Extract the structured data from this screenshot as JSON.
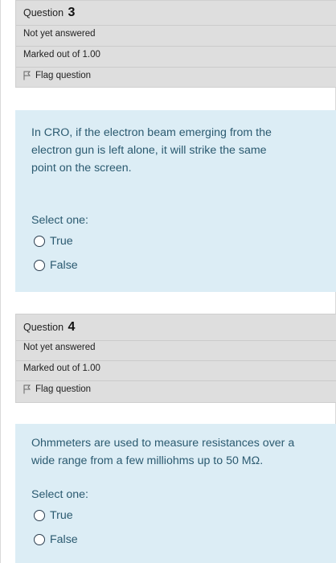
{
  "questions": [
    {
      "label": "Question",
      "number": "3",
      "state": "Not yet answered",
      "marks": "Marked out of 1.00",
      "flag_label": "Flag question",
      "text": "In CRO, if the electron beam emerging from the electron gun is left alone, it will strike the same point on the screen.",
      "prompt": "Select one:",
      "options": [
        "True",
        "False"
      ]
    },
    {
      "label": "Question",
      "number": "4",
      "state": "Not yet answered",
      "marks": "Marked out of 1.00",
      "flag_label": "Flag question",
      "text": "Ohmmeters are used to measure resistances over a wide range from a few milliohms up to 50 MΩ.",
      "prompt": "Select one:",
      "options": [
        "True",
        "False"
      ]
    }
  ],
  "icons": {
    "flag": "flag-icon",
    "radio": "radio-unchecked-icon"
  }
}
